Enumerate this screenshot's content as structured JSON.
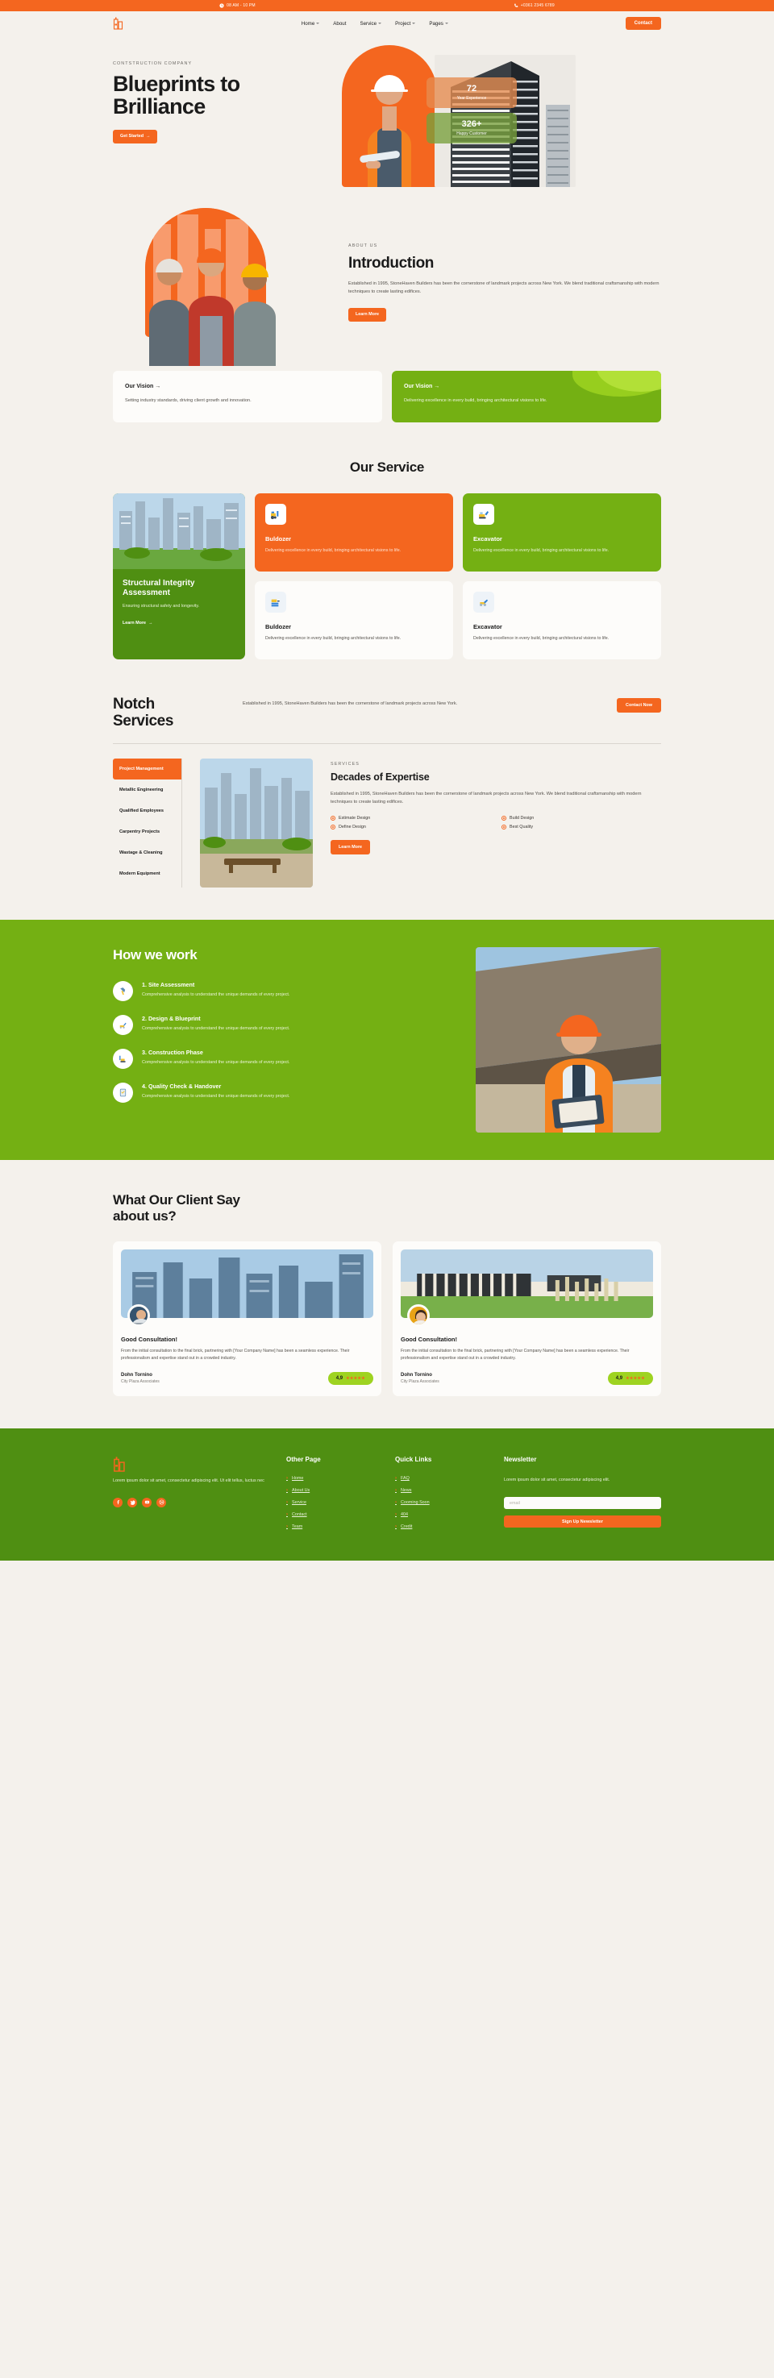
{
  "topbar": {
    "hours": "08 AM - 10 PM",
    "phone": "+0361 2345 6789",
    "clock_icon": "clock-icon",
    "phone_icon": "phone-icon"
  },
  "header": {
    "logo_name": "building-logo",
    "nav": [
      {
        "label": "Home",
        "has_dropdown": true
      },
      {
        "label": "About",
        "has_dropdown": false
      },
      {
        "label": "Service",
        "has_dropdown": true
      },
      {
        "label": "Project",
        "has_dropdown": true
      },
      {
        "label": "Pages",
        "has_dropdown": true
      }
    ],
    "contact_label": "Contact"
  },
  "hero": {
    "eyebrow": "CONTSTRUCTION COMPANY",
    "title_line1": "Blueprints to",
    "title_line2": "Brilliance",
    "cta_label": "Get Started",
    "cta_arrow": "→",
    "stats": [
      {
        "value": "72",
        "label": "Year Experience",
        "color": "#e68c50"
      },
      {
        "value": "326+",
        "label": "Happy Customer",
        "color": "#78a03c"
      }
    ]
  },
  "intro": {
    "eyebrow": "ABOUT US",
    "title": "Introduction",
    "body": "Established in 1995, StoneHaven Builders has been the cornerstone of landmark projects across New York. We blend traditional craftsmanship with modern techniques to create lasting edifices.",
    "cta_label": "Learn More"
  },
  "visions": [
    {
      "title": "Our Vision",
      "arrow": "→",
      "body": "Setting industry standards, driving client growth and innovation.",
      "variant": "light"
    },
    {
      "title": "Our Vision",
      "arrow": "→",
      "body": "Delivering excellence in every build, bringing architectural visions to life.",
      "variant": "green"
    }
  ],
  "service": {
    "title": "Our Service",
    "feature": {
      "title": "Structural Integrity Assessment",
      "body": "Ensuring structural safety and longevity.",
      "cta_label": "Learn More",
      "cta_arrow": "→"
    },
    "cards": [
      {
        "title": "Buldozer",
        "body": "Delivering excellence in every build, bringing architectural visions to life.",
        "variant": "orange",
        "icon": "bulldozer-icon"
      },
      {
        "title": "Excavator",
        "body": "Delivering excellence in every build, bringing architectural visions to life.",
        "variant": "green",
        "icon": "excavator-icon"
      },
      {
        "title": "Buldozer",
        "body": "Delivering excellence in every build, bringing architectural visions to life.",
        "variant": "white",
        "icon": "roller-icon"
      },
      {
        "title": "Excavator",
        "body": "Delivering excellence in every build, bringing architectural visions to life.",
        "variant": "white",
        "icon": "excavator-icon"
      }
    ]
  },
  "notch": {
    "title_line1": "Notch",
    "title_line2": "Services",
    "lead": "Established in 1995, StoneHaven Builders has been the cornerstone of landmark projects across New York.",
    "contact_label": "Contact Now",
    "tabs": [
      {
        "label": "Project Management",
        "active": true
      },
      {
        "label": "Metallic Engineering",
        "active": false
      },
      {
        "label": "Qualified Employees",
        "active": false
      },
      {
        "label": "Carpentry Projects",
        "active": false
      },
      {
        "label": "Wastage & Cleaning",
        "active": false
      },
      {
        "label": "Modern Equipment",
        "active": false
      }
    ],
    "eyebrow": "SERVICES",
    "heading": "Decades of Expertise",
    "body": "Established in 1995, StoneHaven Builders has been the cornerstone of landmark projects across New York. We blend traditional craftsmanship with modern techniques to create lasting edifices.",
    "checks": [
      "Estimate Design",
      "Build Design",
      "Define Design",
      "Best Quality"
    ],
    "cta_label": "Learn More"
  },
  "how": {
    "title": "How we work",
    "steps": [
      {
        "title": "1. Site Assessment",
        "body": "Comprehensive analysis to understand the unique demands of every project.",
        "icon": "hammer-icon"
      },
      {
        "title": "2. Design & Blueprint",
        "body": "Comprehensive analysis to understand the unique demands of every project.",
        "icon": "crane-icon"
      },
      {
        "title": "3. Construction Phase",
        "body": "Comprehensive analysis to understand the unique demands of every project.",
        "icon": "excavator-icon"
      },
      {
        "title": "4. Quality Check & Handover",
        "body": "Comprehensive analysis to understand the unique demands of every project.",
        "icon": "checklist-icon"
      }
    ]
  },
  "testimonials": {
    "title_line1": "What Our Client Say",
    "title_line2": "about us?",
    "cards": [
      {
        "heading": "Good Consultation!",
        "quote": "From the initial consultation to the final brick, partnering with [Your Company Name] has been a seamless experience. Their professionalism and expertise stand out in a crowded industry.",
        "name": "Dohn Tornino",
        "role": "City Plaza Associates",
        "rating": "4,9",
        "stars": "★★★★★"
      },
      {
        "heading": "Good Consultation!",
        "quote": "From the initial consultation to the final brick, partnering with [Your Company Name] has been a seamless experience. Their professionalism and expertise stand out in a crowded industry.",
        "name": "Dohn Tornino",
        "role": "City Plaza Associates",
        "rating": "4,9",
        "stars": "★★★★★"
      }
    ]
  },
  "footer": {
    "brand_logo": "building-logo",
    "about": "Lorem ipsum dolor sit amet, consectetur adipiscing elit. Ut elit tellus, luctus nec",
    "socials": [
      "facebook-icon",
      "twitter-icon",
      "youtube-icon",
      "dribbble-icon"
    ],
    "other_page": {
      "title": "Other Page",
      "links": [
        "Home",
        "About Us",
        "Service",
        "Contact",
        "Team"
      ]
    },
    "quick_links": {
      "title": "Quick Links",
      "links": [
        "FAQ",
        "News",
        "Cooming Soon",
        "404",
        "Credit"
      ]
    },
    "newsletter": {
      "title": "Newsletter",
      "body": "Lorem ipsum dolor sit amet, consectetur adipiscing elit.",
      "email_placeholder": "email",
      "email_value": "",
      "button_label": "Sign Up Newsletter"
    }
  },
  "colors": {
    "orange": "#f4661f",
    "green": "#74b013",
    "dark_green": "#4f8f12",
    "lime": "#9ed321",
    "cream": "#f4f1ec"
  }
}
